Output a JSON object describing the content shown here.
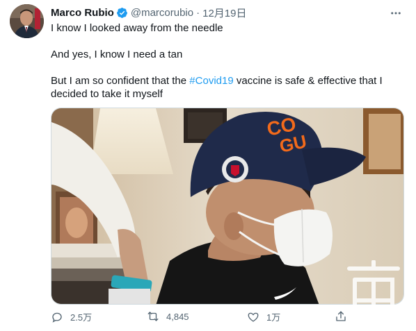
{
  "tweet": {
    "author_name": "Marco Rubio",
    "handle": "@marcorubio",
    "separator": "·",
    "date": "12月19日",
    "more_icon": "more-horizontal-icon",
    "verified_icon": "verified-badge-icon",
    "text": {
      "line1": "I know I looked away from the needle",
      "line2": "And yes, I know I need a tan",
      "line3_before": "But I am so confident that the ",
      "line3_hashtag": "#Covid19",
      "line3_after": " vaccine is safe & effective that I decided to take it myself"
    },
    "media": {
      "cap_letters_1": "CO",
      "cap_letters_2": "GU"
    },
    "actions": {
      "reply_count": "2.5万",
      "retweet_count": "4,845",
      "like_count": "1万"
    }
  },
  "watermark": {
    "text": "一亩三分地"
  },
  "colors": {
    "accent": "#1d9bf0",
    "secondary_text": "#536471",
    "primary_text": "#0f1419"
  }
}
